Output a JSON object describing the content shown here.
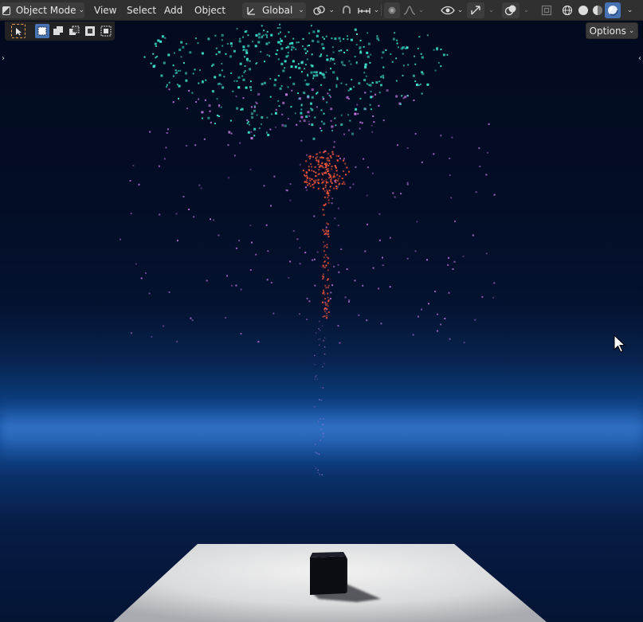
{
  "header": {
    "mode_label": "Object Mode",
    "menus": [
      "View",
      "Select",
      "Add",
      "Object"
    ],
    "transform_orientation": "Global"
  },
  "toolbar": {
    "options_label": "Options"
  },
  "icons": {
    "editor_type": "3d-viewport-icon",
    "orientation": "transform-orientation-icon",
    "pivot": "pivot-point-icon",
    "snap": "snap-icon",
    "snap_increment": "snap-increment-icon",
    "proportional": "proportional-editing-icon",
    "falloff": "falloff-icon",
    "visibility": "visibility-eye-icon",
    "gizmo": "gizmo-icon",
    "overlays": "overlays-icon",
    "xray": "xray-icon",
    "wireframe": "wireframe-shading-icon",
    "solid": "solid-shading-icon",
    "material": "material-shading-icon",
    "rendered": "rendered-shading-icon"
  },
  "colors": {
    "header_bg": "#303030",
    "accent": "#4772b3",
    "firework_teal": "#3fe6cf",
    "firework_violet": "#c77be8",
    "firework_red": "#ff5a3c",
    "horizon_blue": "#1656a6"
  }
}
